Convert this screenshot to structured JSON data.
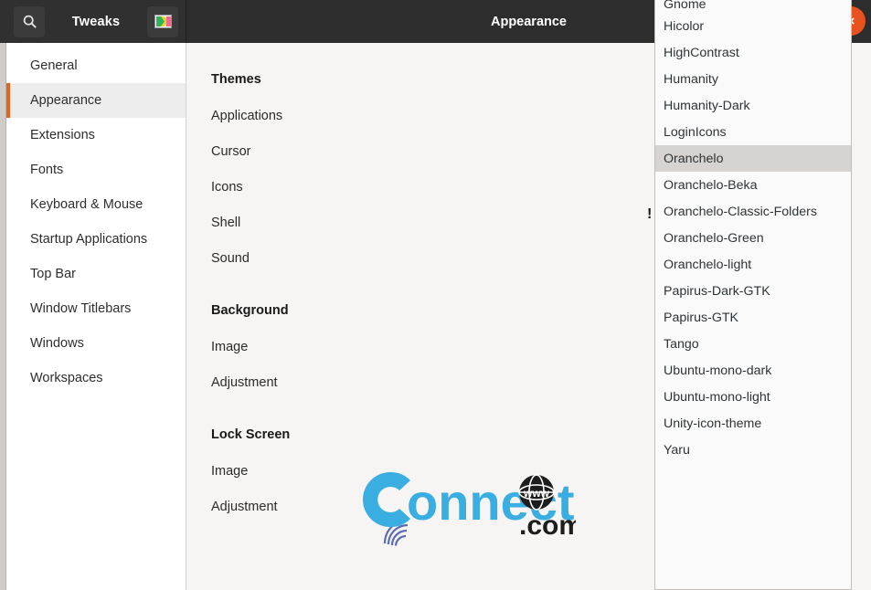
{
  "window": {
    "app_title": "Tweaks",
    "page_title": "Appearance",
    "search_icon": "search-icon",
    "theme_preview_icon": "image-theme-icon",
    "close_icon": "close-icon",
    "close_label": "×"
  },
  "sidebar": {
    "items": [
      {
        "label": "General",
        "active": false
      },
      {
        "label": "Appearance",
        "active": true
      },
      {
        "label": "Extensions",
        "active": false
      },
      {
        "label": "Fonts",
        "active": false
      },
      {
        "label": "Keyboard & Mouse",
        "active": false
      },
      {
        "label": "Startup Applications",
        "active": false
      },
      {
        "label": "Top Bar",
        "active": false
      },
      {
        "label": "Window Titlebars",
        "active": false
      },
      {
        "label": "Windows",
        "active": false
      },
      {
        "label": "Workspaces",
        "active": false
      }
    ]
  },
  "content": {
    "sections": [
      {
        "heading": "Themes",
        "rows": [
          "Applications",
          "Cursor",
          "Icons",
          "Shell",
          "Sound"
        ]
      },
      {
        "heading": "Background",
        "rows": [
          "Image",
          "Adjustment"
        ]
      },
      {
        "heading": "Lock Screen",
        "rows": [
          "Image",
          "Adjustment"
        ]
      }
    ],
    "marker": "!",
    "watermark": {
      "text": "Connect",
      "suffix": ".com",
      "globe_text": "www",
      "color": "#3aaee0"
    }
  },
  "dropdown": {
    "items": [
      {
        "label": "Gnome",
        "selected": false,
        "clipped": true
      },
      {
        "label": "Hicolor",
        "selected": false
      },
      {
        "label": "HighContrast",
        "selected": false
      },
      {
        "label": "Humanity",
        "selected": false
      },
      {
        "label": "Humanity-Dark",
        "selected": false
      },
      {
        "label": "LoginIcons",
        "selected": false
      },
      {
        "label": "Oranchelo",
        "selected": true
      },
      {
        "label": "Oranchelo-Beka",
        "selected": false
      },
      {
        "label": "Oranchelo-Classic-Folders",
        "selected": false
      },
      {
        "label": "Oranchelo-Green",
        "selected": false
      },
      {
        "label": "Oranchelo-light",
        "selected": false
      },
      {
        "label": "Papirus-Dark-GTK",
        "selected": false
      },
      {
        "label": "Papirus-GTK",
        "selected": false
      },
      {
        "label": "Tango",
        "selected": false
      },
      {
        "label": "Ubuntu-mono-dark",
        "selected": false
      },
      {
        "label": "Ubuntu-mono-light",
        "selected": false
      },
      {
        "label": "Unity-icon-theme",
        "selected": false
      },
      {
        "label": "Yaru",
        "selected": false
      }
    ]
  },
  "colors": {
    "accent": "#e8621d",
    "close": "#e8521f",
    "headerbar": "#2d2d2d",
    "selected_row": "#d6d3d0",
    "sidebar_active": "#ededed"
  }
}
